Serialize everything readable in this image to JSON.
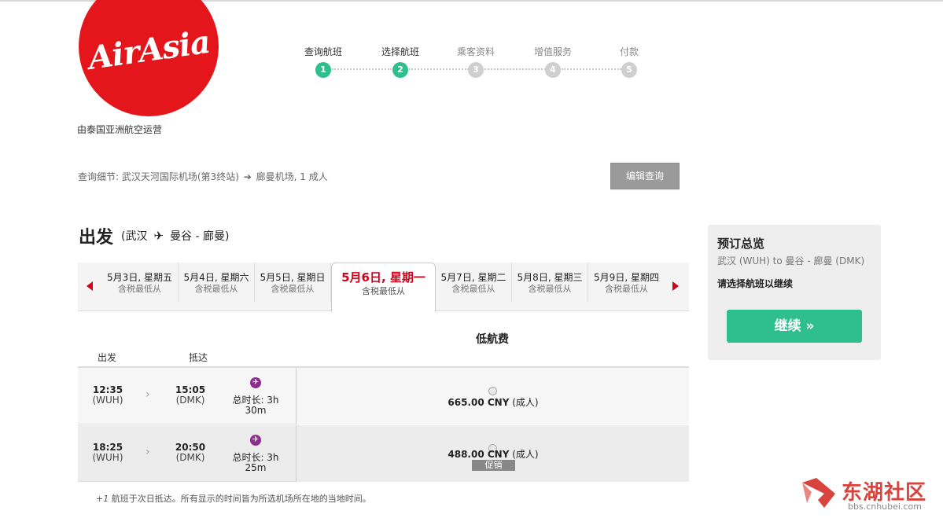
{
  "brand": {
    "logo_text": "AirAsia",
    "operated_by": "由泰国亚洲航空运营",
    "color": "#e4161c"
  },
  "progress": {
    "steps": [
      {
        "label": "查询航班",
        "number": "1",
        "state": "done"
      },
      {
        "label": "选择航班",
        "number": "2",
        "state": "current"
      },
      {
        "label": "乘客资料",
        "number": "3",
        "state": "pending"
      },
      {
        "label": "增值服务",
        "number": "4",
        "state": "pending"
      },
      {
        "label": "付款",
        "number": "5",
        "state": "pending"
      }
    ],
    "active_color": "#2fbf8f"
  },
  "search": {
    "details_prefix": "查询细节:",
    "origin": "武汉天河国际机场(第3终站)",
    "arrow": "➔",
    "destination": "廊曼机场,",
    "passengers": "1 成人",
    "edit_label": "编辑查询"
  },
  "departure": {
    "title": "出发",
    "route_open": "(武汉",
    "plane_icon": "airplane-icon",
    "route_close": "曼谷 - 廊曼)"
  },
  "dates": {
    "tabs": [
      {
        "date": "5月3日, 星期五",
        "sub": "含税最低从",
        "active": false
      },
      {
        "date": "5月4日, 星期六",
        "sub": "含税最低从",
        "active": false
      },
      {
        "date": "5月5日, 星期日",
        "sub": "含税最低从",
        "active": false
      },
      {
        "date": "5月6日, 星期一",
        "sub": "含税最低从",
        "active": true
      },
      {
        "date": "5月7日, 星期二",
        "sub": "含税最低从",
        "active": false
      },
      {
        "date": "5月8日, 星期三",
        "sub": "含税最低从",
        "active": false
      },
      {
        "date": "5月9日, 星期四",
        "sub": "含税最低从",
        "active": false
      }
    ],
    "accent": "#d0021b"
  },
  "table": {
    "fare_header": "低航费",
    "col_departure": "出发",
    "col_arrival": "抵达",
    "flights": [
      {
        "dep_time": "12:35",
        "dep_code": "(WUH)",
        "arr_time": "15:05",
        "arr_code": "(DMK)",
        "duration_line1": "总时长: 3h",
        "duration_line2": "30m",
        "price": "665.00 CNY",
        "price_suffix": "(成人)",
        "promo": ""
      },
      {
        "dep_time": "18:25",
        "dep_code": "(WUH)",
        "arr_time": "20:50",
        "arr_code": "(DMK)",
        "duration_line1": "总时长: 3h",
        "duration_line2": "25m",
        "price": "488.00 CNY",
        "price_suffix": "(成人)",
        "promo": "促销"
      }
    ],
    "footnote_mark": "+1",
    "footnote": " 航班于次日抵达。所有显示的时间皆为所选机场所在地的当地时间。"
  },
  "summary": {
    "title": "预订总览",
    "route": "武汉 (WUH) to 曼谷 - 廊曼 (DMK)",
    "note": "请选择航班以继续",
    "continue_label": "继续 »",
    "button_color": "#2fbf8f"
  },
  "watermark": {
    "text": "东湖社区",
    "url": "bbs.cnhubei.com"
  }
}
